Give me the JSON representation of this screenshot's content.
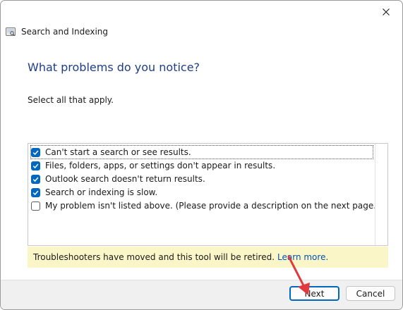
{
  "window": {
    "title": "Search and Indexing"
  },
  "main": {
    "heading": "What problems do you notice?",
    "instruction": "Select all that apply.",
    "options": [
      {
        "label": "Can't start a search or see results.",
        "checked": true
      },
      {
        "label": "Files, folders, apps, or settings don't appear in results.",
        "checked": true
      },
      {
        "label": "Outlook search doesn't return results.",
        "checked": true
      },
      {
        "label": "Search or indexing is slow.",
        "checked": true
      },
      {
        "label": "My problem isn't listed above. (Please provide a description on the next page.)",
        "checked": false
      }
    ],
    "notice": {
      "text": "Troubleshooters have moved and this tool will be retired.",
      "link": "Learn more."
    }
  },
  "footer": {
    "next_label": "Next",
    "cancel_label": "Cancel"
  },
  "colors": {
    "heading": "#1e3e8a",
    "accent": "#0067c0",
    "notice_bg": "#fbf6c8",
    "annotation_arrow": "#e0393e"
  },
  "icons": {
    "close": "close-icon",
    "app": "search-indexing-app-icon",
    "check": "checkmark-icon"
  }
}
